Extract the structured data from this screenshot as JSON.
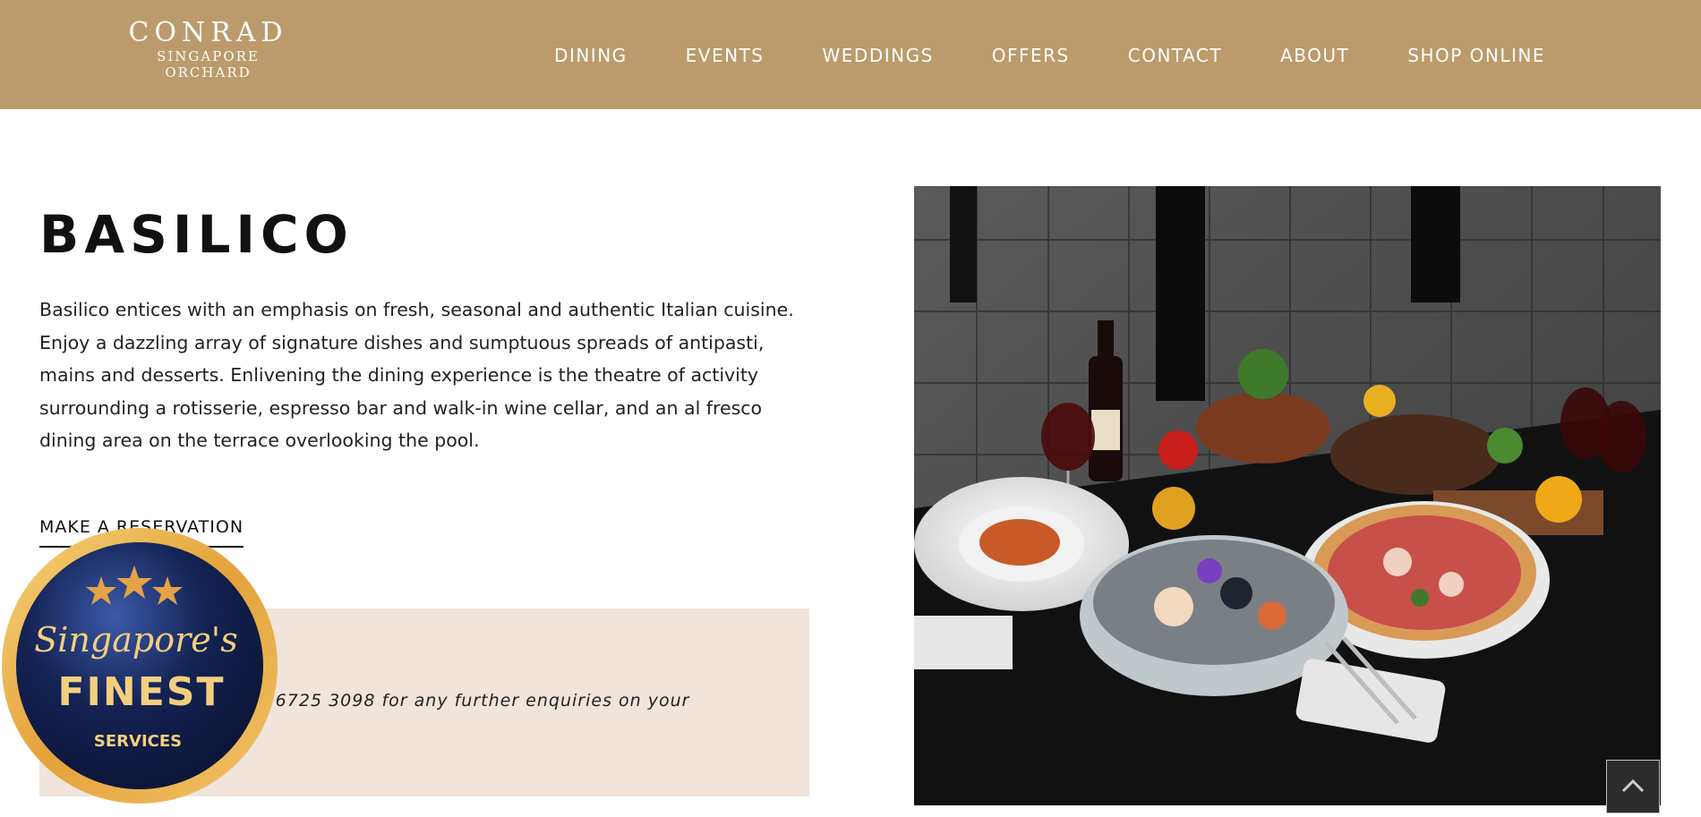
{
  "brand": {
    "name": "CONRAD",
    "line1": "SINGAPORE",
    "line2": "ORCHARD"
  },
  "nav": [
    {
      "label": "DINING"
    },
    {
      "label": "EVENTS"
    },
    {
      "label": "WEDDINGS"
    },
    {
      "label": "OFFERS"
    },
    {
      "label": "CONTACT"
    },
    {
      "label": "ABOUT"
    },
    {
      "label": "SHOP ONLINE"
    }
  ],
  "restaurant": {
    "title": "BASILICO",
    "description": "Basilico entices with an emphasis on fresh, seasonal and authentic Italian cuisine. Enjoy a dazzling array of signature dishes and sumptuous spreads of antipasti, mains and desserts. Enlivening the dining experience is the theatre of activity surrounding a rotisserie, espresso bar and walk-in wine cellar, and an al fresco dining area on the terrace overlooking the pool.",
    "reservation_label": "MAKE A RESERVATION",
    "enquiry_text": "call 6725 3098 for any further enquiries on your"
  },
  "badge": {
    "line1": "Singapore's",
    "line2": "FINEST",
    "line3": "SERVICES"
  },
  "colors": {
    "header_bg": "#bb9b6b",
    "enquiry_bg": "#f0e4db",
    "badge_gold": "#e8b04a",
    "badge_navy": "#0f1a3e"
  },
  "icons": {
    "scroll_top": "chevron-up-icon"
  }
}
